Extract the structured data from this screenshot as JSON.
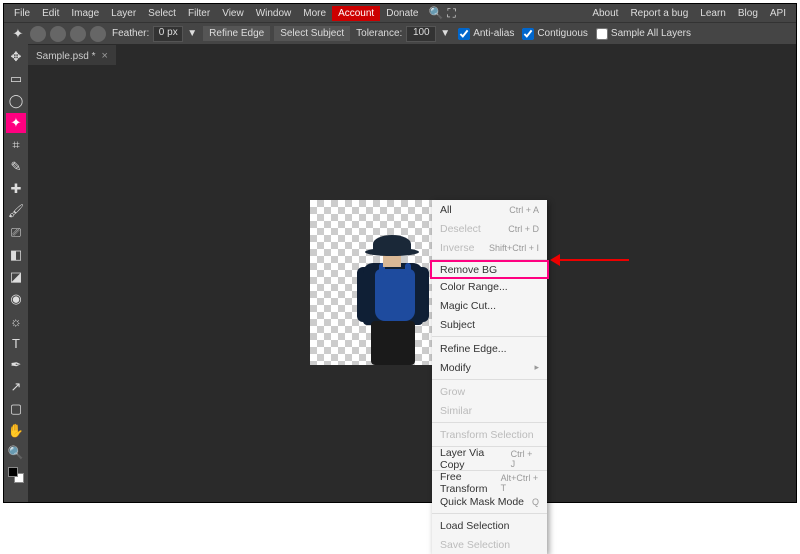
{
  "menubar": {
    "items": [
      "File",
      "Edit",
      "Image",
      "Layer",
      "Select",
      "Filter",
      "View",
      "Window",
      "More"
    ],
    "account": "Account",
    "donate": "Donate",
    "right": [
      "About",
      "Report a bug",
      "Learn",
      "Blog",
      "API"
    ]
  },
  "optbar": {
    "feather_lbl": "Feather:",
    "feather_val": "0 px",
    "refine": "Refine Edge",
    "selectSubj": "Select Subject",
    "tol_lbl": "Tolerance:",
    "tol_val": "100",
    "antialias": "Anti-alias",
    "contiguous": "Contiguous",
    "sampleAll": "Sample All Layers"
  },
  "tab": {
    "name": "Sample.psd *"
  },
  "ctxmenu": {
    "items": [
      {
        "label": "All",
        "shortcut": "Ctrl + A",
        "dis": false
      },
      {
        "label": "Deselect",
        "shortcut": "Ctrl + D",
        "dis": true
      },
      {
        "label": "Inverse",
        "shortcut": "Shift+Ctrl + I",
        "dis": true
      },
      {
        "sep": true
      },
      {
        "label": "Remove BG",
        "shortcut": "",
        "dis": false,
        "hl": true
      },
      {
        "label": "Color Range...",
        "shortcut": "",
        "dis": false
      },
      {
        "label": "Magic Cut...",
        "shortcut": "",
        "dis": false
      },
      {
        "label": "Subject",
        "shortcut": "",
        "dis": false
      },
      {
        "sep": true
      },
      {
        "label": "Refine Edge...",
        "shortcut": "",
        "dis": false
      },
      {
        "label": "Modify",
        "shortcut": "▸",
        "dis": false
      },
      {
        "sep": true
      },
      {
        "label": "Grow",
        "shortcut": "",
        "dis": true
      },
      {
        "label": "Similar",
        "shortcut": "",
        "dis": true
      },
      {
        "sep": true
      },
      {
        "label": "Transform Selection",
        "shortcut": "",
        "dis": true
      },
      {
        "sep": true
      },
      {
        "label": "Layer Via Copy",
        "shortcut": "Ctrl + J",
        "dis": false
      },
      {
        "sep": true
      },
      {
        "label": "Free Transform",
        "shortcut": "Alt+Ctrl + T",
        "dis": false
      },
      {
        "label": "Quick Mask Mode",
        "shortcut": "Q",
        "dis": false
      },
      {
        "sep": true
      },
      {
        "label": "Load Selection",
        "shortcut": "",
        "dis": false
      },
      {
        "label": "Save Selection",
        "shortcut": "",
        "dis": true
      }
    ]
  },
  "tools": [
    {
      "n": "move",
      "g": "✥"
    },
    {
      "n": "rect-select",
      "g": "▭"
    },
    {
      "n": "lasso",
      "g": "◯"
    },
    {
      "n": "magic-wand",
      "g": "✦",
      "hl": true
    },
    {
      "n": "crop",
      "g": "⌗"
    },
    {
      "n": "eyedropper",
      "g": "✎"
    },
    {
      "n": "heal",
      "g": "✚"
    },
    {
      "n": "brush",
      "g": "🖌"
    },
    {
      "n": "stamp",
      "g": "⎚"
    },
    {
      "n": "eraser",
      "g": "◧"
    },
    {
      "n": "gradient",
      "g": "◪"
    },
    {
      "n": "blur",
      "g": "◉"
    },
    {
      "n": "dodge",
      "g": "☼"
    },
    {
      "n": "type",
      "g": "T"
    },
    {
      "n": "pen",
      "g": "✒"
    },
    {
      "n": "path",
      "g": "↗"
    },
    {
      "n": "rect",
      "g": "▢"
    },
    {
      "n": "hand",
      "g": "✋"
    },
    {
      "n": "zoom",
      "g": "🔍"
    }
  ]
}
